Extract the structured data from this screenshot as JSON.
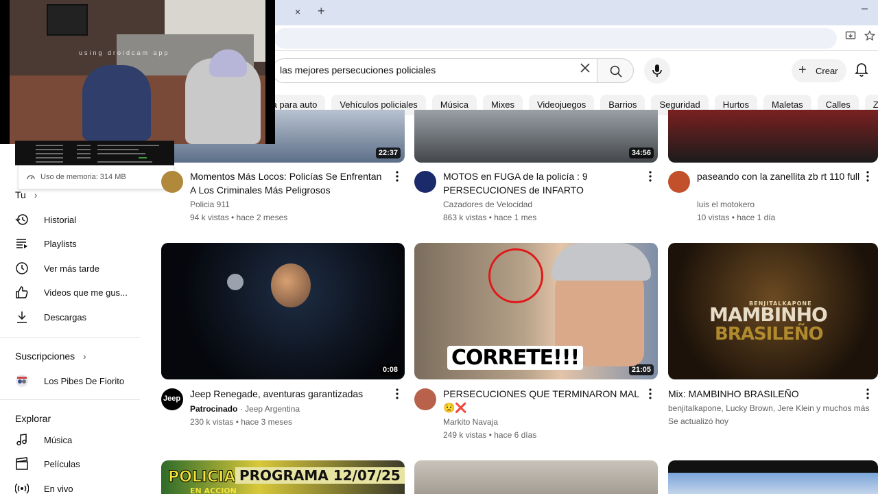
{
  "browser": {
    "tab_close": "×",
    "tab_new": "+",
    "window_min": "–"
  },
  "header": {
    "search_query": "las mejores persecuciones policiales",
    "create_label": "Crear"
  },
  "chips": [
    "Barra para auto",
    "Vehículos policiales",
    "Música",
    "Mixes",
    "Videojuegos",
    "Barrios",
    "Seguridad",
    "Hurtos",
    "Maletas",
    "Calles",
    "Zapatos"
  ],
  "sidebar": {
    "memory": "Uso de memoria: 314 MB",
    "you_heading": "Tu",
    "you_items": [
      {
        "label": "Historial",
        "icon": "history-icon"
      },
      {
        "label": "Playlists",
        "icon": "playlists-icon"
      },
      {
        "label": "Ver más tarde",
        "icon": "watch-later-icon"
      },
      {
        "label": "Videos que me gus...",
        "icon": "thumbs-up-icon"
      },
      {
        "label": "Descargas",
        "icon": "download-icon"
      }
    ],
    "subs_heading": "Suscripciones",
    "subs_items": [
      {
        "label": "Los Pibes De Fiorito",
        "icon": "channel-avatar-icon"
      }
    ],
    "explore_heading": "Explorar",
    "explore_items": [
      {
        "label": "Música",
        "icon": "music-icon"
      },
      {
        "label": "Películas",
        "icon": "movies-icon"
      },
      {
        "label": "En vivo",
        "icon": "live-icon"
      }
    ]
  },
  "webcam": {
    "watermark": "using droidcam app"
  },
  "videos": [
    {
      "title": "Momentos Más Locos: Policías Se Enfrentan A Los Criminales Más Peligrosos",
      "channel": "Policia 911",
      "stats": "94 k vistas • hace 2 meses",
      "duration": "22:37"
    },
    {
      "title": "MOTOS en FUGA de la policía : 9 PERSECUCIONES de INFARTO",
      "channel": "Cazadores de Velocidad",
      "stats": "863 k vistas • hace 1 mes",
      "duration": "34:56"
    },
    {
      "title": "paseando con la zanellita zb rt 110 full",
      "channel": "luis el motokero",
      "stats": "10 vistas • hace 1 día",
      "duration": ""
    },
    {
      "title": "Jeep Renegade, aventuras garantizadas",
      "sponsor": "Patrocinado",
      "channel": "Jeep Argentina",
      "stats": "230 k vistas • hace 3 meses",
      "duration": "0:08",
      "avatar_text": "Jeep"
    },
    {
      "title": "PERSECUCIONES QUE TERMINARON MAL 😟❌",
      "channel": "Markito Navaja",
      "stats": "249 k vistas • hace 6 días",
      "duration": "21:05",
      "thumb_text": "CORRETE!!!"
    },
    {
      "title": "Mix: MAMBINHO BRASILEÑO",
      "channel": "benjitalkapone, Lucky Brown, Jere Klein y muchos más",
      "stats": "Se actualizó hoy",
      "duration": "",
      "thumb_small": "BENJITALKAPONE",
      "thumb_big1": "MAMBINHO",
      "thumb_big2": "BRASILEÑO"
    }
  ],
  "row3": {
    "thumb1_text1": "POLICIAS",
    "thumb1_text2": "PROGRAMA 12/07/25",
    "thumb1_text3": "EN ACCION"
  }
}
